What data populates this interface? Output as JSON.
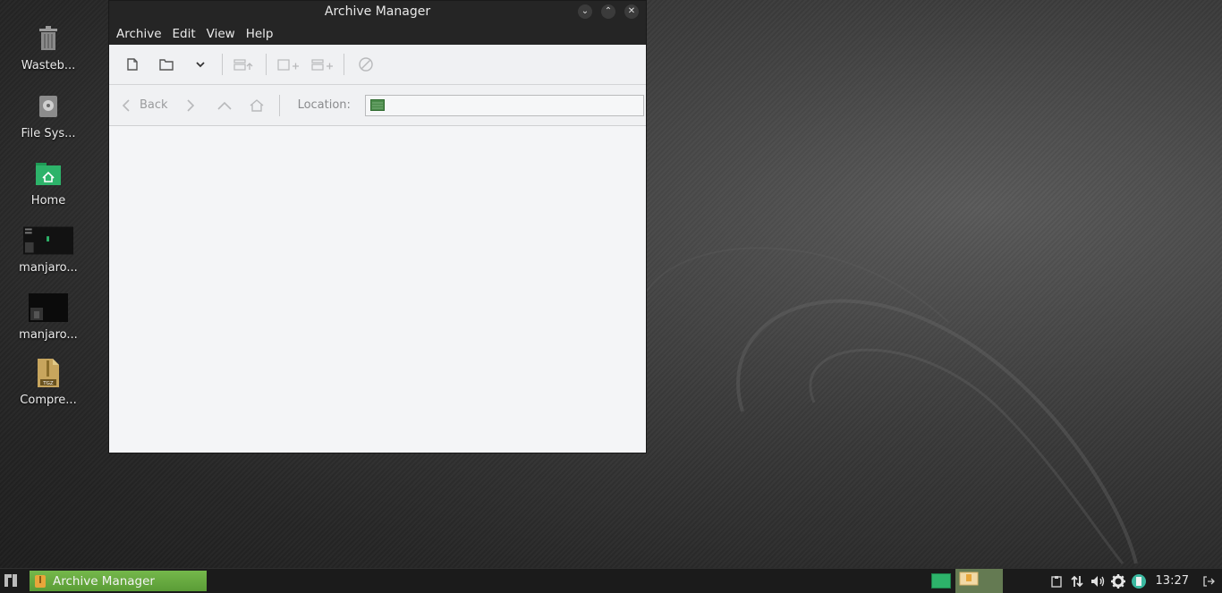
{
  "desktop": {
    "icons": [
      {
        "label": "Wasteb..."
      },
      {
        "label": "File Sys..."
      },
      {
        "label": "Home"
      },
      {
        "label": "manjaro..."
      },
      {
        "label": "manjaro..."
      },
      {
        "label": "Compre..."
      }
    ]
  },
  "window": {
    "title": "Archive Manager",
    "menu": [
      "Archive",
      "Edit",
      "View",
      "Help"
    ],
    "nav": {
      "back_label": "Back",
      "location_label": "Location:"
    }
  },
  "taskbar": {
    "task_label": "Archive Manager",
    "clock": "13:27"
  },
  "colors": {
    "accent_green": "#5fa43a",
    "titlebar_bg": "#252525",
    "window_bg": "#f4f5f7"
  }
}
